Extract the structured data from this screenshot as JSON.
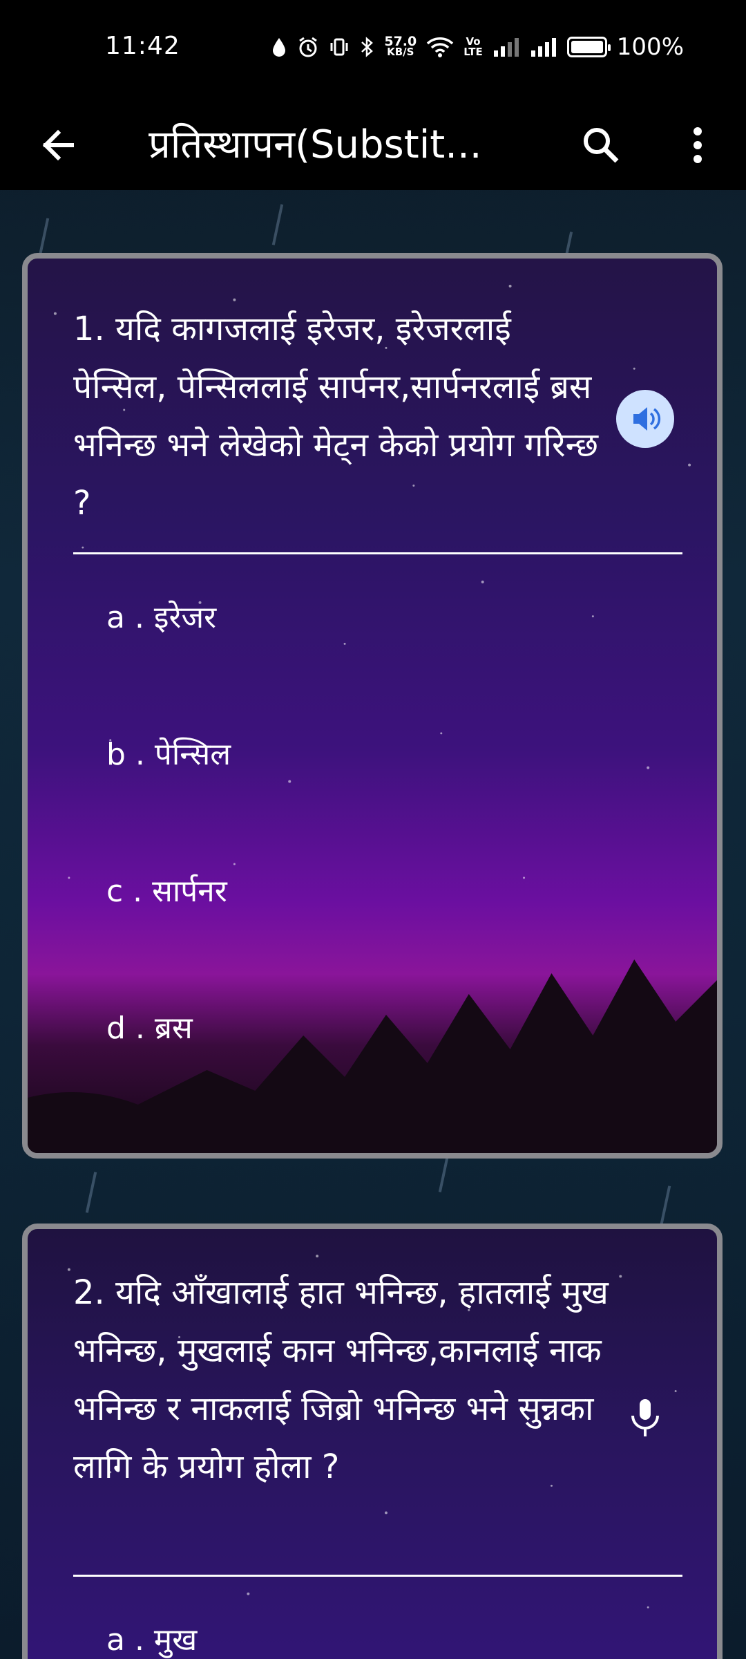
{
  "status_bar": {
    "time": "11:42",
    "net_speed_value": "57.0",
    "net_speed_unit": "KB/S",
    "volte_top": "Vo",
    "volte_bottom": "LTE",
    "battery": "100%"
  },
  "app_bar": {
    "title": "प्रतिस्थापन(Substit..."
  },
  "questions": [
    {
      "text": "1. यदि कागजलाई इरेजर, इरेजरलाई पेन्सिल, पेन्सिललाई सार्पनर,सार्पनरलाई ब्रस भनिन्छ भने लेखेको मेट्न केको प्रयोग गरिन्छ ?",
      "options": [
        "a . इरेजर",
        "b . पेन्सिल",
        "c . सार्पनर",
        "d . ब्रस"
      ]
    },
    {
      "text": "2. यदि आँखालाई हात भनिन्छ, हातलाई मुख भनिन्छ, मुखलाई कान भनिन्छ,कानलाई नाक भनिन्छ र नाकलाई जिब्रो भनिन्छ भने सुन्नका लागि के प्रयोग होला ?",
      "options": [
        "a . मुख"
      ]
    }
  ],
  "colors": {
    "app_bar": "#000000",
    "card_border": "#8a8a8f",
    "speaker_bg": "#cfe2ff",
    "speaker_icon": "#2f6fe0"
  },
  "icons": {
    "back": "arrow-left-icon",
    "search": "search-icon",
    "more": "more-vert-icon",
    "speaker": "speaker-icon",
    "mic": "mic-icon"
  }
}
